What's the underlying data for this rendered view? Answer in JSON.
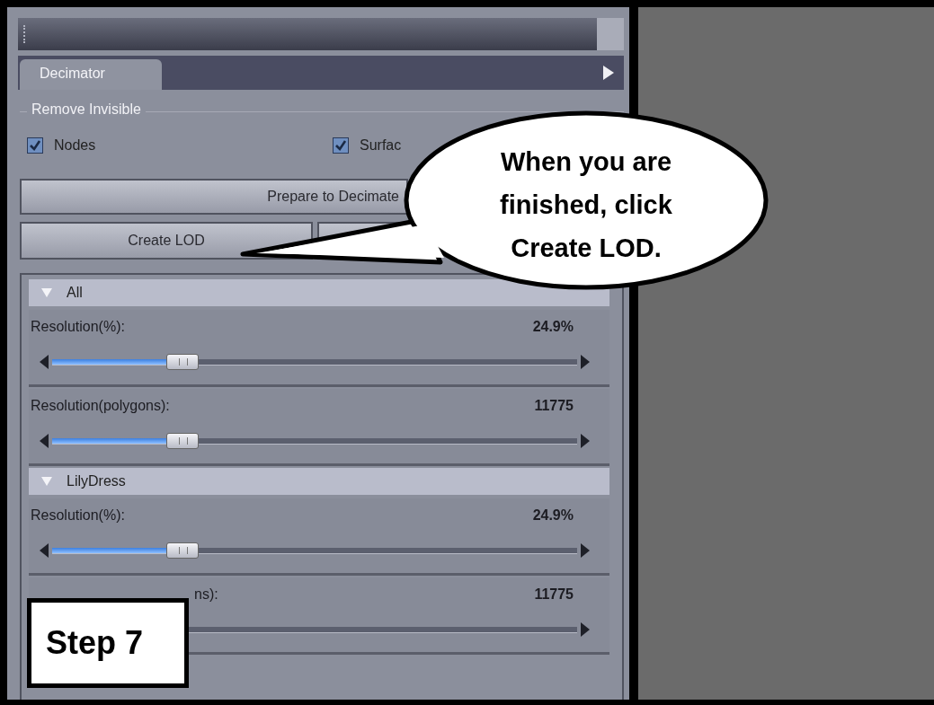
{
  "panel": {
    "tabs": [
      {
        "label": "Decimator",
        "selected": true
      }
    ],
    "group": {
      "title": "Remove Invisible",
      "checkboxes": [
        {
          "label": "Nodes",
          "checked": true
        },
        {
          "label": "Surfac",
          "checked": true
        }
      ]
    },
    "prepare_button": "Prepare to Decimate",
    "create_button": "Create LOD",
    "sections": [
      {
        "title": "All",
        "expanded": true,
        "sliders": [
          {
            "label": "Resolution(%):",
            "value": "24.9%",
            "level": 0.249
          },
          {
            "label": "Resolution(polygons):",
            "value": "11775",
            "level": 0.249
          }
        ]
      },
      {
        "title": "LilyDress",
        "expanded": true,
        "sliders": [
          {
            "label": "Resolution(%):",
            "value": "24.9%",
            "level": 0.249
          },
          {
            "label": "ns):",
            "value": "11775"
          }
        ]
      }
    ]
  },
  "callout": {
    "lines": [
      "When you are",
      "finished, click",
      "Create LOD."
    ]
  },
  "step_label": "Step 7"
}
